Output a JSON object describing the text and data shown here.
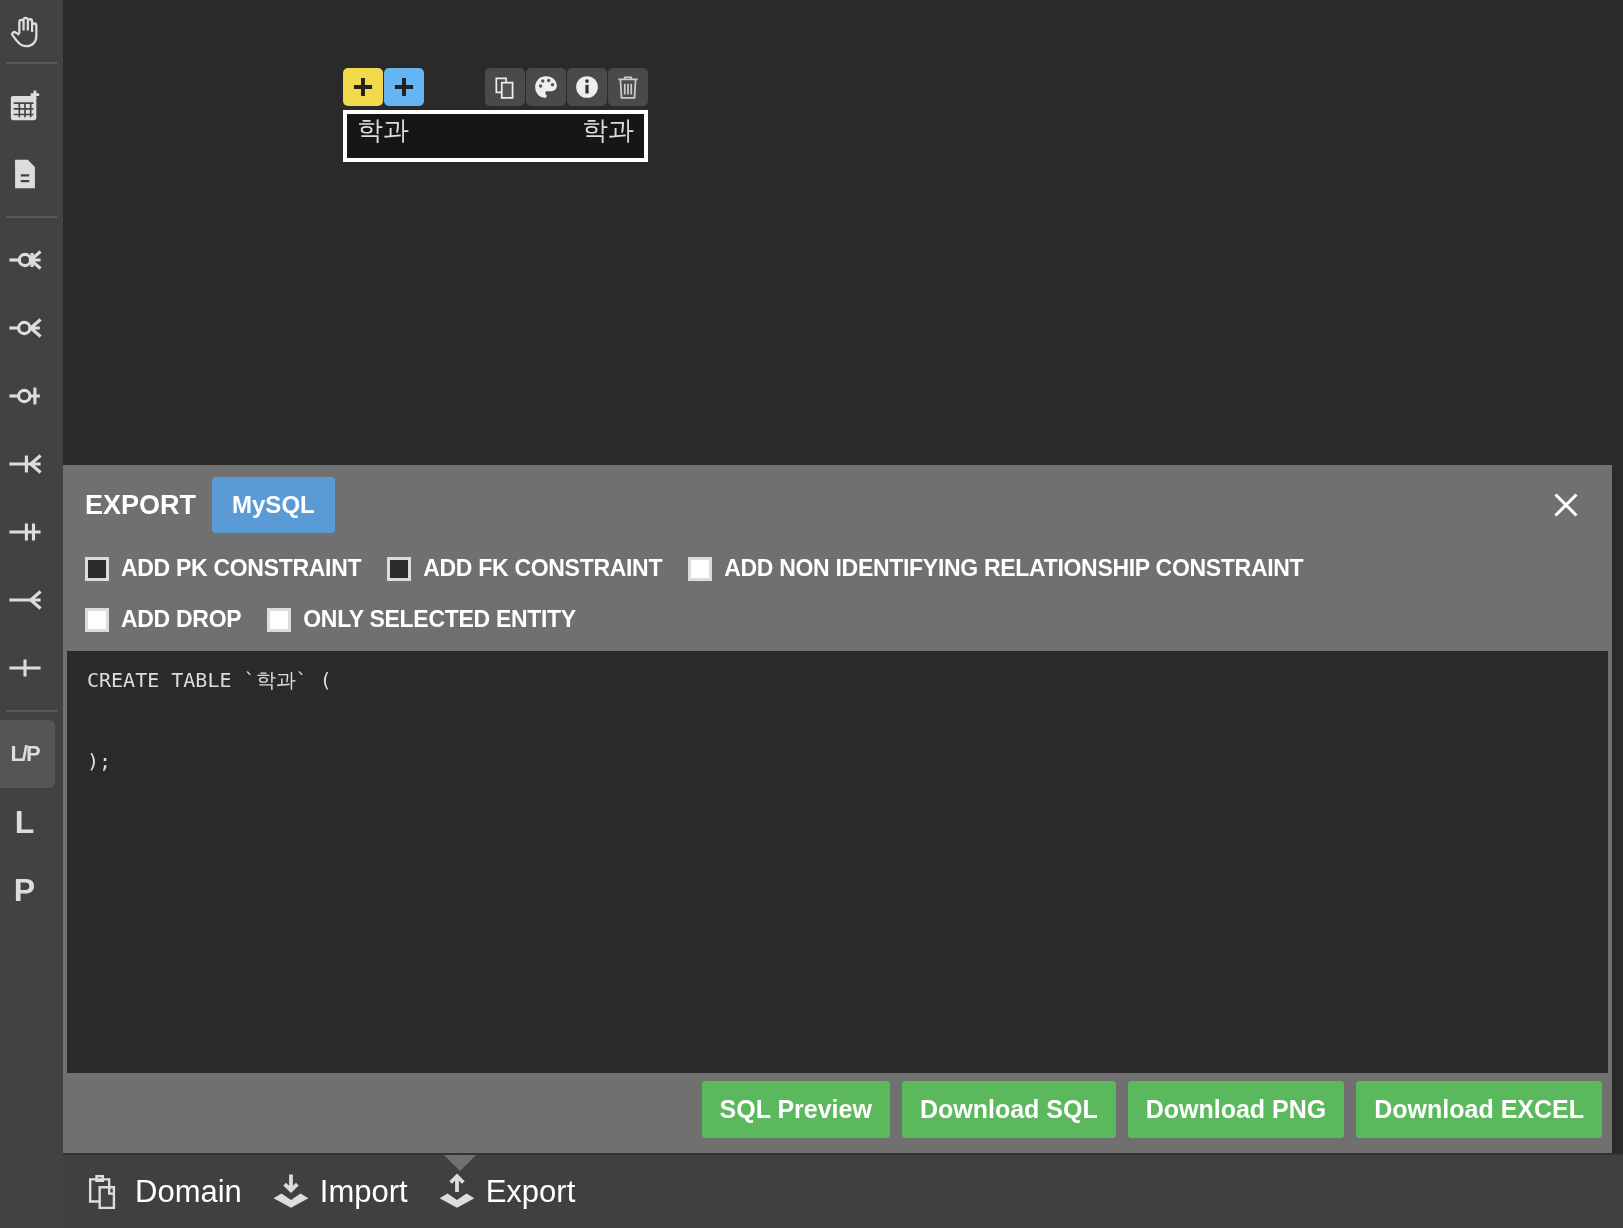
{
  "sidebar": {
    "tools": [
      {
        "kind": "hand",
        "selected": false
      },
      {
        "kind": "divider"
      },
      {
        "kind": "table-add",
        "selected": false
      },
      {
        "kind": "memo",
        "selected": false
      },
      {
        "kind": "divider"
      },
      {
        "kind": "zero-one-many",
        "selected": false
      },
      {
        "kind": "zero-many",
        "selected": false
      },
      {
        "kind": "zero-one",
        "selected": false
      },
      {
        "kind": "one-many",
        "selected": false
      },
      {
        "kind": "one-only",
        "selected": false
      },
      {
        "kind": "many",
        "selected": false
      },
      {
        "kind": "one",
        "selected": false
      },
      {
        "kind": "divider"
      },
      {
        "kind": "glyph",
        "glyph": "L/P",
        "selected": true
      },
      {
        "kind": "glyph",
        "glyph": "L",
        "selected": false
      },
      {
        "kind": "glyph",
        "glyph": "P",
        "selected": false
      }
    ]
  },
  "entity": {
    "labels": [
      "학과",
      "학과"
    ],
    "toolbar": [
      {
        "kind": "add-yellow"
      },
      {
        "kind": "add-blue"
      },
      {
        "kind": "gap"
      },
      {
        "kind": "copy"
      },
      {
        "kind": "palette"
      },
      {
        "kind": "info"
      },
      {
        "kind": "trash"
      }
    ]
  },
  "export_panel": {
    "title": "EXPORT",
    "dialects": [
      {
        "label": "MySQL",
        "selected": true
      }
    ],
    "option_rows": [
      [
        {
          "label": "ADD PK CONSTRAINT",
          "checked": true
        },
        {
          "label": "ADD FK CONSTRAINT",
          "checked": true
        },
        {
          "label": "ADD NON IDENTIFYING RELATIONSHIP CONSTRAINT",
          "checked": false
        }
      ],
      [
        {
          "label": "ADD DROP",
          "checked": false
        },
        {
          "label": "ONLY SELECTED ENTITY",
          "checked": false
        }
      ]
    ],
    "code": "CREATE TABLE `학과` (\n\n\n);",
    "buttons": [
      "SQL Preview",
      "Download SQL",
      "Download PNG",
      "Download EXCEL"
    ]
  },
  "bottom_bar": {
    "items": [
      {
        "kind": "domain",
        "label": "Domain",
        "selected": false
      },
      {
        "kind": "import",
        "label": "Import",
        "selected": false
      },
      {
        "kind": "export",
        "label": "Export",
        "selected": true
      }
    ]
  }
}
